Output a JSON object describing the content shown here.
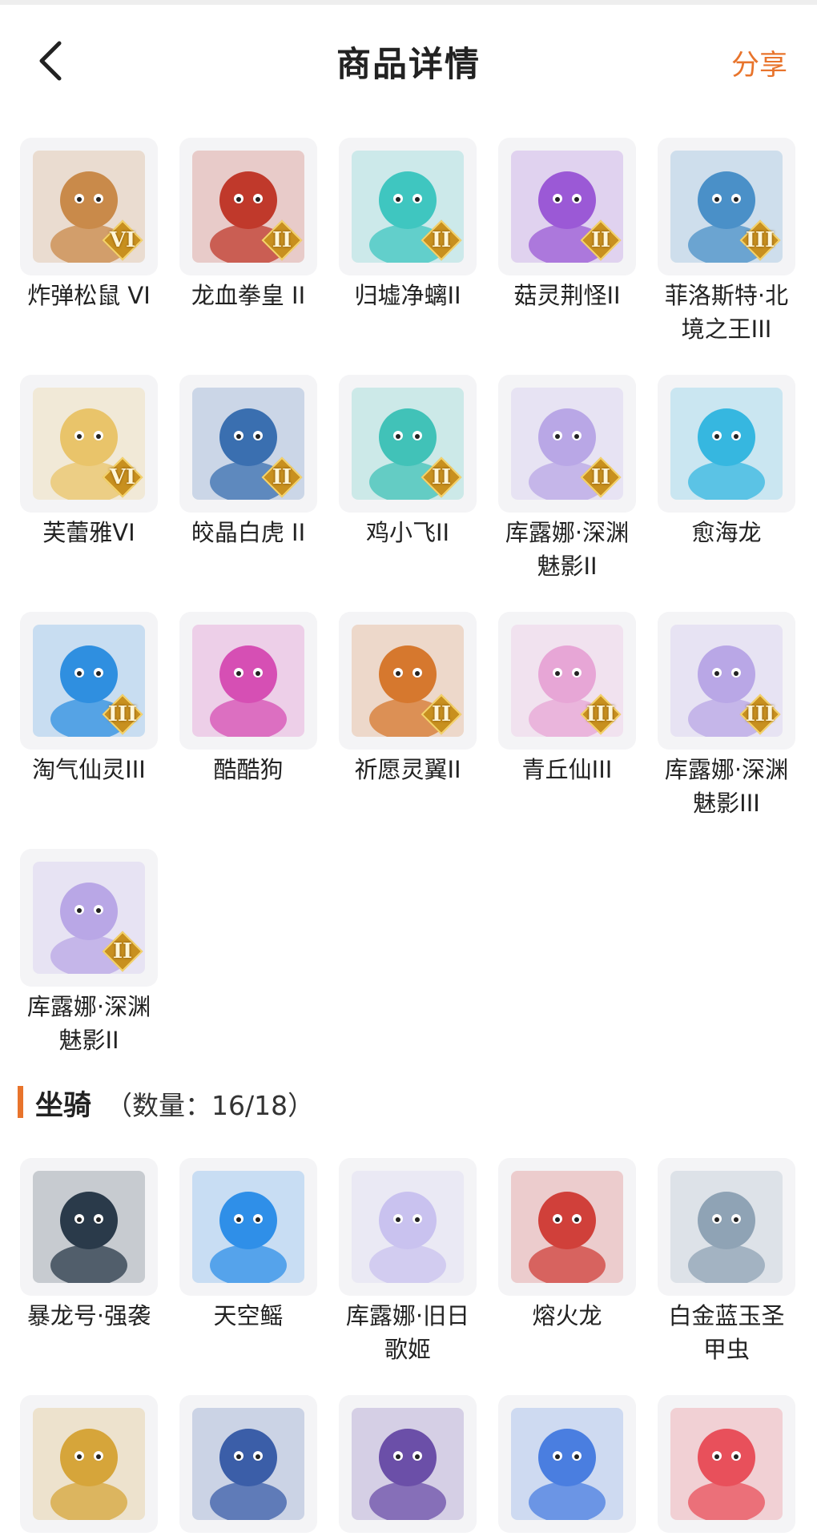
{
  "header": {
    "back_icon": "chevron-left-icon",
    "title": "商品详情",
    "share_label": "分享"
  },
  "skins": [
    {
      "name": "炸弹松鼠 VI",
      "tier": "VI",
      "color": "#c98a4a"
    },
    {
      "name": "龙血拳皇 II",
      "tier": "II",
      "color": "#c0392b"
    },
    {
      "name": "归墟净螭II",
      "tier": "II",
      "color": "#3fc6c0"
    },
    {
      "name": "菇灵荆怪II",
      "tier": "II",
      "color": "#9b59d6"
    },
    {
      "name": "菲洛斯特·北境之王III",
      "tier": "III",
      "color": "#4a90c8"
    },
    {
      "name": "芙蕾雅VI",
      "tier": "VI",
      "color": "#e9c46a"
    },
    {
      "name": "皎晶白虎 II",
      "tier": "II",
      "color": "#3a6fb0"
    },
    {
      "name": "鸡小飞II",
      "tier": "II",
      "color": "#41c2b8"
    },
    {
      "name": "库露娜·深渊魅影II",
      "tier": "II",
      "color": "#b9a7e6"
    },
    {
      "name": "愈海龙",
      "tier": "",
      "color": "#36b7e0"
    },
    {
      "name": "淘气仙灵III",
      "tier": "III",
      "color": "#2f8fe0"
    },
    {
      "name": "酷酷狗",
      "tier": "",
      "color": "#d64fb4"
    },
    {
      "name": "祈愿灵翼II",
      "tier": "II",
      "color": "#d6782e"
    },
    {
      "name": "青丘仙III",
      "tier": "III",
      "color": "#e7a6d6"
    },
    {
      "name": "库露娜·深渊魅影III",
      "tier": "III",
      "color": "#b9a7e6"
    },
    {
      "name": "库露娜·深渊魅影II",
      "tier": "II",
      "color": "#b9a7e6"
    }
  ],
  "mounts_section": {
    "title": "坐骑",
    "count_text": "（数量：16/18）"
  },
  "mounts": [
    {
      "name": "暴龙号·强袭",
      "tier": "",
      "color": "#2a3a4a"
    },
    {
      "name": "天空鳐",
      "tier": "",
      "color": "#2f8fe8"
    },
    {
      "name": "库露娜·旧日歌姬",
      "tier": "",
      "color": "#c9c2ef"
    },
    {
      "name": "熔火龙",
      "tier": "",
      "color": "#d0403a"
    },
    {
      "name": "白金蓝玉圣甲虫",
      "tier": "",
      "color": "#8fa3b5"
    },
    {
      "name": "",
      "tier": "",
      "color": "#d6a53a"
    },
    {
      "name": "",
      "tier": "",
      "color": "#3b5ea8"
    },
    {
      "name": "",
      "tier": "",
      "color": "#6b4fa8"
    },
    {
      "name": "",
      "tier": "",
      "color": "#4a7ee0"
    },
    {
      "name": "",
      "tier": "",
      "color": "#e8505b"
    }
  ]
}
